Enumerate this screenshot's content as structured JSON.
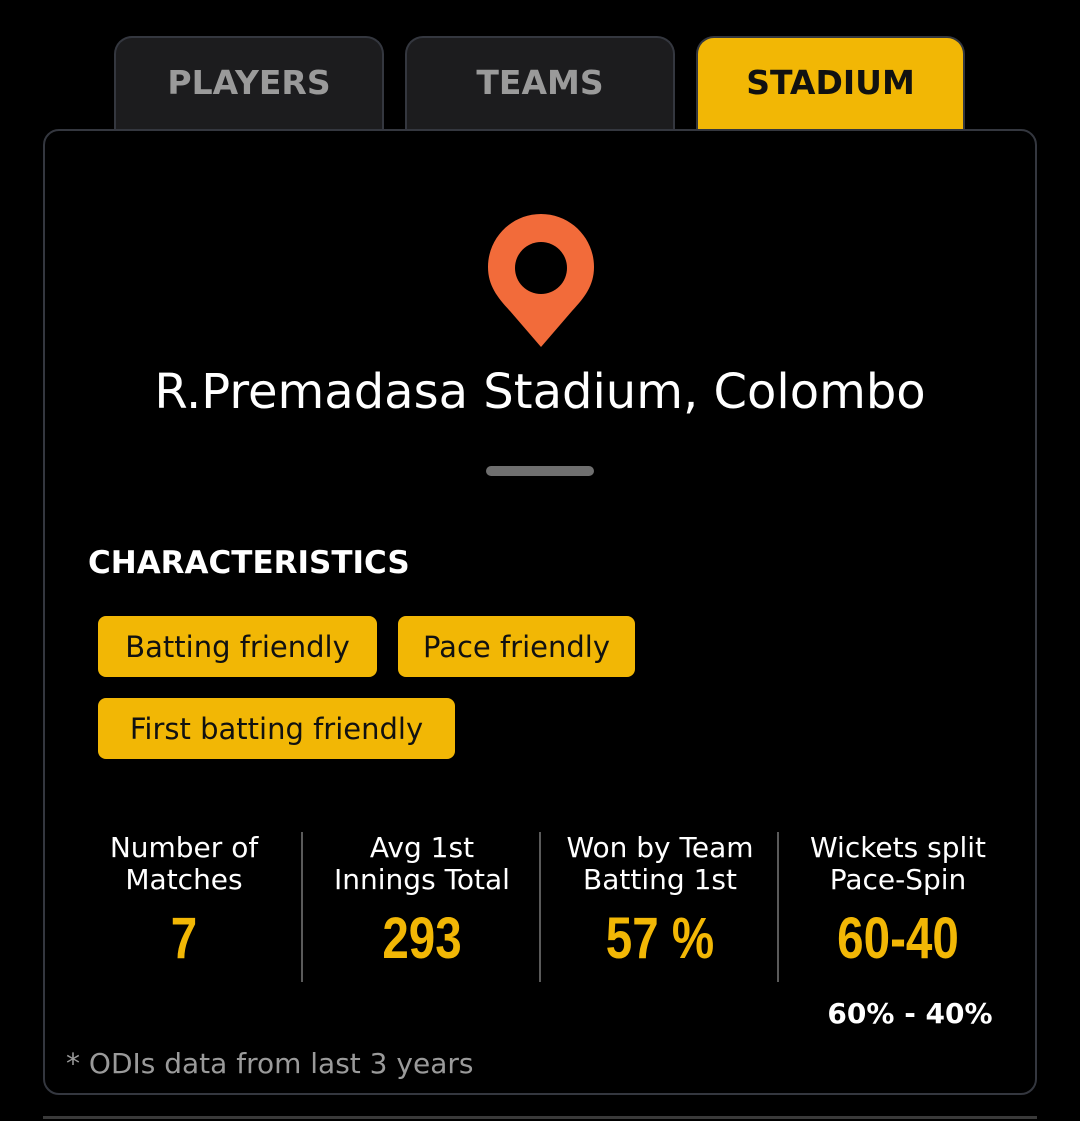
{
  "tabs": [
    {
      "label": "PLAYERS",
      "active": false
    },
    {
      "label": "TEAMS",
      "active": false
    },
    {
      "label": "STADIUM",
      "active": true
    }
  ],
  "stadium": {
    "icon": "location-pin-icon",
    "name": "R.Premadasa Stadium, Colombo"
  },
  "characteristics": {
    "heading": "CHARACTERISTICS",
    "tags": [
      "Batting friendly",
      "Pace friendly",
      "First batting friendly"
    ]
  },
  "stats": [
    {
      "label": "Number of\nMatches",
      "value": "7"
    },
    {
      "label": "Avg 1st\nInnings Total",
      "value": "293"
    },
    {
      "label": "Won by Team\nBatting 1st",
      "value": "57 %"
    },
    {
      "label": "Wickets split\nPace-Spin",
      "value": "60-40"
    }
  ],
  "wickets_split_detail": "60% - 40%",
  "footnote": "* ODIs data from last 3 years",
  "colors": {
    "accent": "#f2b705",
    "pin": "#f26b3a",
    "background": "#000000",
    "tab_inactive": "#1c1c1e",
    "border": "#34373f"
  }
}
